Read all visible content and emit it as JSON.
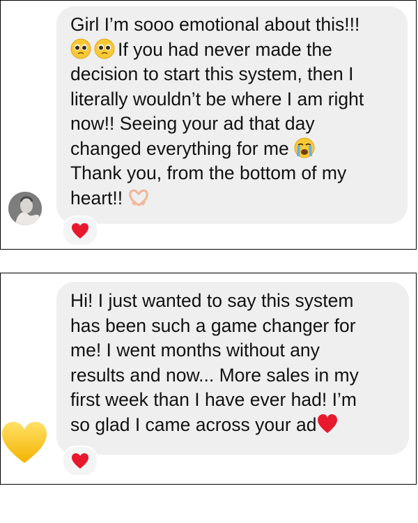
{
  "messages": [
    {
      "lines": [
        "Girl I’m sooo emotional about this!!!",
        "If you had never made the",
        "decision to start this system, then I",
        "literally wouldn’t be where I am right",
        "now!! Seeing your ad that day",
        "changed everything for me",
        "Thank you, from the bottom of my",
        "heart!!"
      ],
      "inline_icons": [
        "pleading-face-icon",
        "pleading-face-icon",
        "crying-face-icon",
        "heart-hands-icon"
      ],
      "reaction_icon": "red-heart-icon",
      "avatar_icon": "profile-photo"
    },
    {
      "lines": [
        "Hi! I just wanted to say this system",
        "has been such a game changer for",
        "me! I went months without any",
        "results and now... More sales in my",
        "first week than I have ever had! I’m",
        "so glad I came across your ad"
      ],
      "inline_icons": [
        "red-heart-icon"
      ],
      "reaction_icon": "red-heart-icon",
      "sender_icon": "yellow-heart-icon"
    }
  ],
  "colors": {
    "bubble": "#efefef",
    "text": "#111111",
    "heart_red": "#e8192c",
    "heart_yellow": "#ffcc22"
  }
}
